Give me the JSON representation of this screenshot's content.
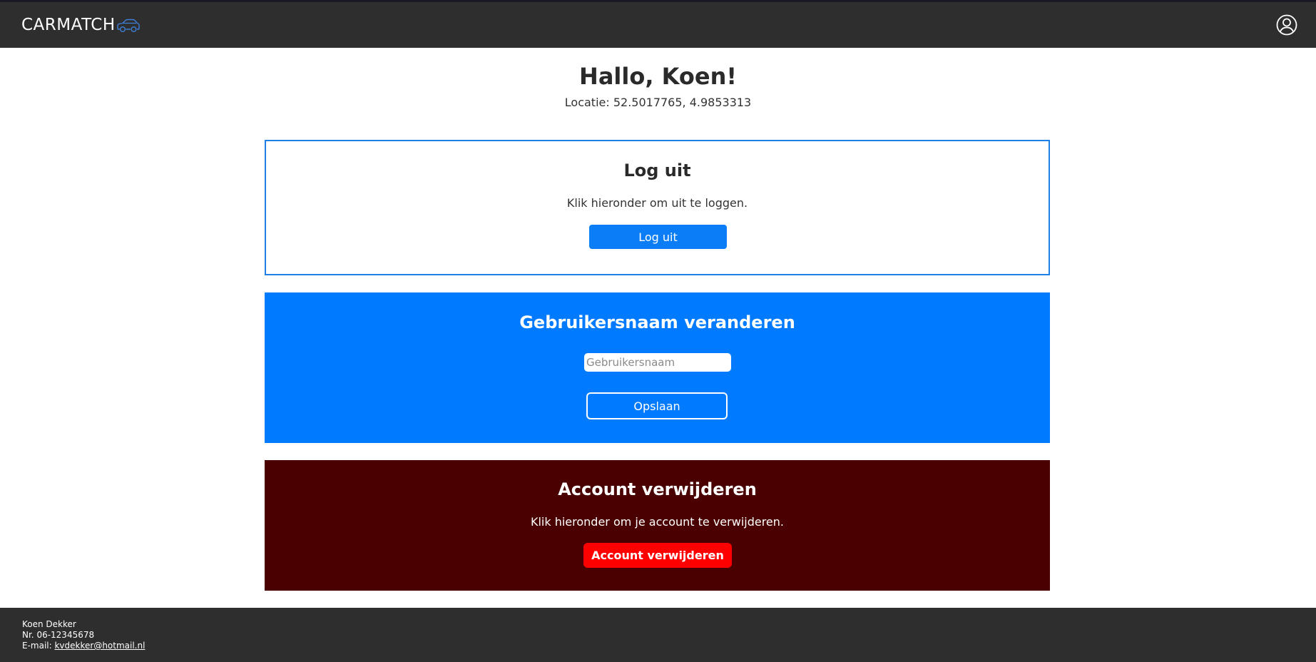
{
  "app": {
    "brand": "CARMATCH",
    "brand_icon": "car-icon",
    "profile_icon": "user-circle-icon"
  },
  "header": {
    "greeting": "Hallo, Koen!",
    "location": "Locatie: 52.5017765, 4.9853313"
  },
  "logout_card": {
    "title": "Log uit",
    "text": "Klik hieronder om uit te loggen.",
    "button_label": "Log uit"
  },
  "username_card": {
    "title": "Gebruikersnaam veranderen",
    "input_value": "",
    "input_placeholder": "Gebruikersnaam",
    "save_label": "Opslaan"
  },
  "delete_card": {
    "title": "Account verwijderen",
    "text": "Klik hieronder om je account te verwijderen.",
    "button_label": "Account verwijderen"
  },
  "footer": {
    "name": "Koen Dekker",
    "phone": "Nr. 06-12345678",
    "email_label": "E-mail: ",
    "email": "kvdekker@hotmail.nl"
  },
  "colors": {
    "nav_bg": "#2e2e2e",
    "primary_blue": "#007bff",
    "danger_bg": "#4a0000",
    "danger_red": "#ff0000"
  }
}
